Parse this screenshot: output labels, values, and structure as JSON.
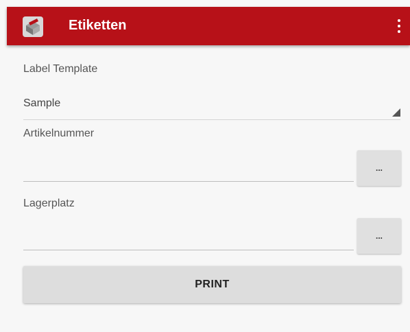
{
  "app": {
    "title": "Etiketten",
    "icon": "box-printer-icon",
    "accent_color": "#b71118",
    "menu_icon": "overflow-menu-icon"
  },
  "form": {
    "template_label": "Label Template",
    "template_value": "Sample",
    "article_label": "Artikelnummer",
    "article_value": "",
    "article_button": "...",
    "location_label": "Lagerplatz",
    "location_value": "",
    "location_button": "...",
    "print_label": "PRINT"
  }
}
